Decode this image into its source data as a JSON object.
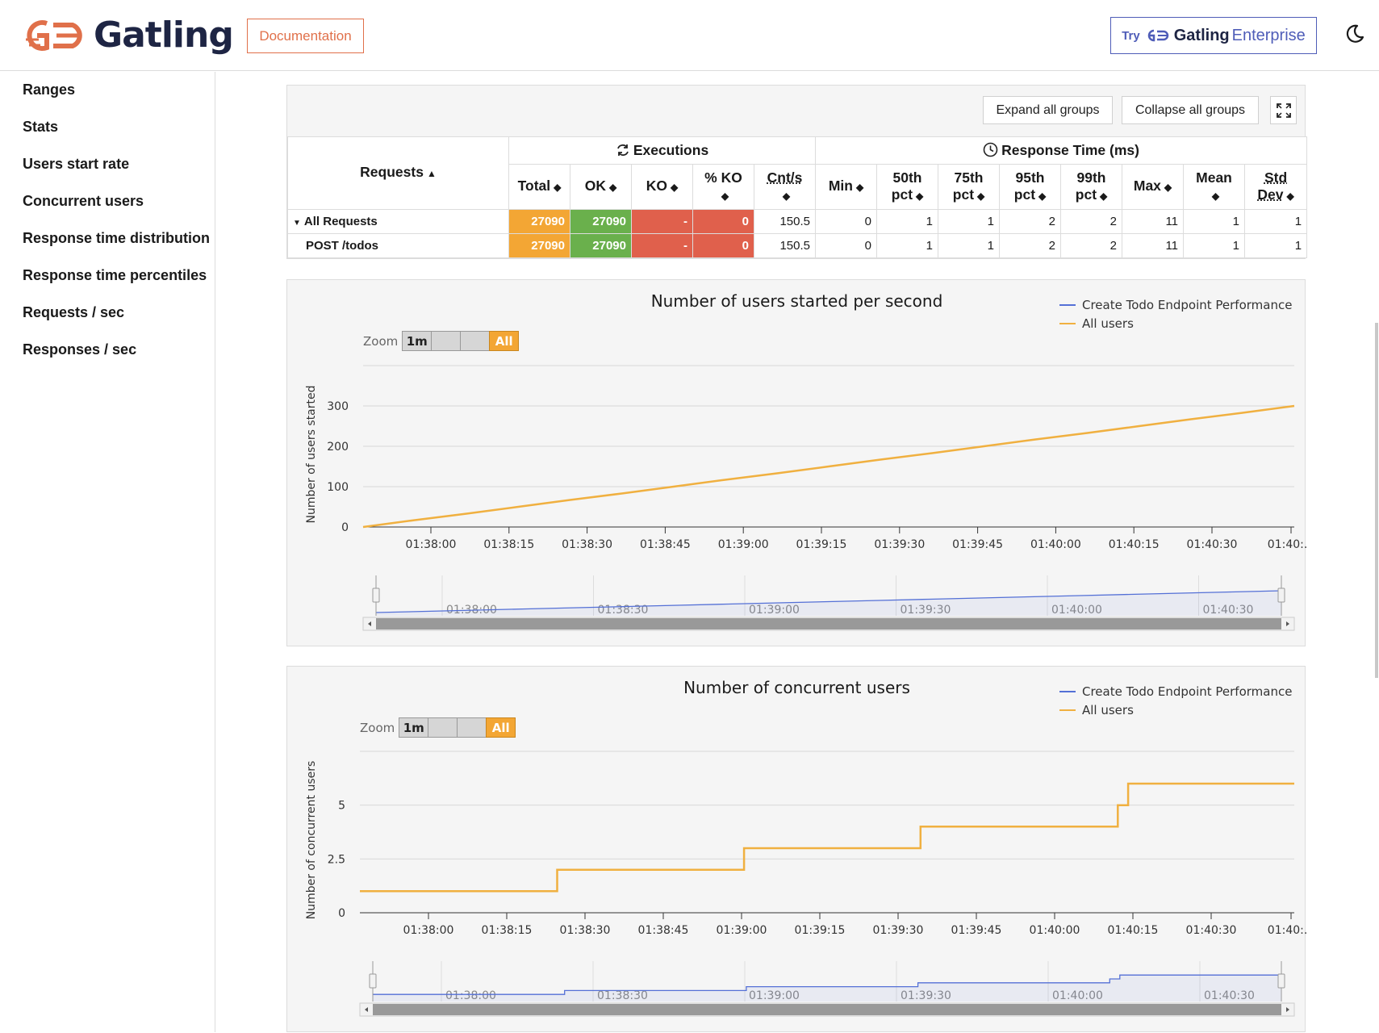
{
  "header": {
    "brand": "Gatling",
    "documentation_label": "Documentation",
    "enterprise": {
      "try": "Try",
      "gatling": "Gatling",
      "enterprise": "Enterprise"
    },
    "theme_icon": "moon-icon",
    "accent_orange": "#e0704a",
    "accent_blue": "#4f5db8"
  },
  "sidebar": {
    "items": [
      {
        "label": "Ranges"
      },
      {
        "label": "Stats"
      },
      {
        "label": "Users start rate"
      },
      {
        "label": "Concurrent users"
      },
      {
        "label": "Response time distribution"
      },
      {
        "label": "Response time percentiles"
      },
      {
        "label": "Requests / sec"
      },
      {
        "label": "Responses / sec"
      }
    ]
  },
  "stats": {
    "expand_label": "Expand all groups",
    "collapse_label": "Collapse all groups",
    "fullscreen_icon": "expand-icon",
    "requests_header": "Requests",
    "executions_header": "Executions",
    "response_time_header": "Response Time (ms)",
    "columns": {
      "total": "Total",
      "ok": "OK",
      "ko": "KO",
      "pct_ko": "% KO",
      "cnt_s": "Cnt/s",
      "min": "Min",
      "p50_a": "50th",
      "p50_b": "pct",
      "p75_a": "75th",
      "p75_b": "pct",
      "p95_a": "95th",
      "p95_b": "pct",
      "p99_a": "99th",
      "p99_b": "pct",
      "max": "Max",
      "mean": "Mean",
      "std_a": "Std",
      "std_b": "Dev"
    },
    "rows": [
      {
        "name": "All Requests",
        "total": "27090",
        "ok": "27090",
        "ko": "-",
        "pct_ko": "0",
        "cnt_s": "150.5",
        "min": "0",
        "p50": "1",
        "p75": "1",
        "p95": "2",
        "p99": "2",
        "max": "11",
        "mean": "1",
        "std": "1"
      },
      {
        "name": "POST /todos",
        "total": "27090",
        "ok": "27090",
        "ko": "-",
        "pct_ko": "0",
        "cnt_s": "150.5",
        "min": "0",
        "p50": "1",
        "p75": "1",
        "p95": "2",
        "p99": "2",
        "max": "11",
        "mean": "1",
        "std": "1"
      }
    ]
  },
  "chart_data": [
    {
      "type": "line",
      "title": "Number of users started per second",
      "ylabel": "Number of users started",
      "xlabel": "",
      "y_ticks": [
        "0",
        "100",
        "200",
        "300"
      ],
      "ylim": [
        0,
        400
      ],
      "x_ticks": [
        "01:38:00",
        "01:38:15",
        "01:38:30",
        "01:38:45",
        "01:39:00",
        "01:39:15",
        "01:39:30",
        "01:39:45",
        "01:40:00",
        "01:40:15",
        "01:40:30",
        "01:40:..."
      ],
      "navigator_ticks": [
        "01:38:00",
        "01:38:30",
        "01:39:00",
        "01:39:30",
        "01:40:00",
        "01:40:30"
      ],
      "legend": [
        "Create Todo Endpoint Performance",
        "All users"
      ],
      "zoom": {
        "label": "Zoom",
        "buttons": [
          "1m",
          "",
          "",
          "All"
        ]
      },
      "series": [
        {
          "name": "All users",
          "color": "#f0b040",
          "x": [
            0,
            10,
            20,
            30,
            40,
            50,
            60,
            70,
            80,
            90,
            100,
            110,
            120,
            130,
            140,
            150,
            160,
            170,
            180
          ],
          "values": [
            0,
            17,
            33,
            50,
            67,
            83,
            100,
            117,
            133,
            150,
            167,
            183,
            200,
            217,
            233,
            250,
            267,
            283,
            300
          ]
        }
      ]
    },
    {
      "type": "line",
      "title": "Number of concurrent users",
      "ylabel": "Number of concurrent users",
      "xlabel": "",
      "y_ticks": [
        "0",
        "2.5",
        "5"
      ],
      "ylim": [
        0,
        7.5
      ],
      "x_ticks": [
        "01:38:00",
        "01:38:15",
        "01:38:30",
        "01:38:45",
        "01:39:00",
        "01:39:15",
        "01:39:30",
        "01:39:45",
        "01:40:00",
        "01:40:15",
        "01:40:30",
        "01:40:..."
      ],
      "navigator_ticks": [
        "01:38:00",
        "01:38:30",
        "01:39:00",
        "01:39:30",
        "01:40:00",
        "01:40:30"
      ],
      "legend": [
        "Create Todo Endpoint Performance",
        "All users"
      ],
      "zoom": {
        "label": "Zoom",
        "buttons": [
          "1m",
          "",
          "",
          "All"
        ]
      },
      "series": [
        {
          "name": "All users",
          "color": "#f0b040",
          "x": [
            0,
            38,
            38,
            74,
            74,
            108,
            108,
            146,
            146,
            148,
            148,
            180
          ],
          "values": [
            1,
            1,
            2,
            2,
            3,
            3,
            4,
            4,
            5,
            5,
            6,
            6
          ]
        }
      ]
    }
  ]
}
